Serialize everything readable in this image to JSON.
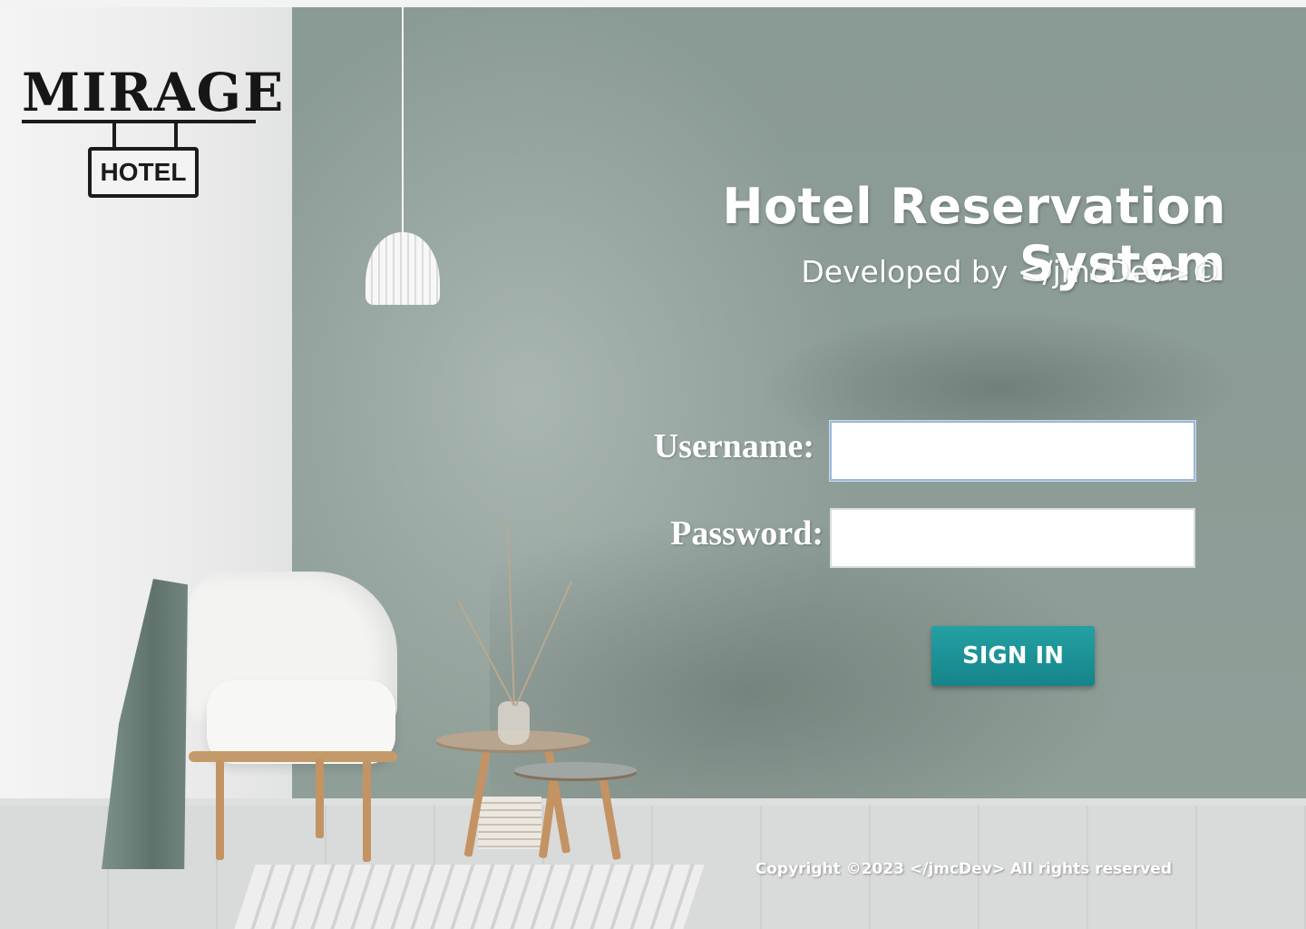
{
  "logo": {
    "name": "MIRAGE",
    "sign": "HOTEL"
  },
  "header": {
    "title": "Hotel Reservation System",
    "subtitle": "Developed by </jmcDev>©"
  },
  "login": {
    "username_label": "Username:",
    "username_value": "",
    "password_label": "Password:",
    "password_value": "",
    "submit_label": "SIGN IN"
  },
  "footer": {
    "copyright": "Copyright ©2023 </jmcDev> All rights reserved"
  },
  "colors": {
    "accent": "#1a9599",
    "wall": "#8d9c96"
  },
  "icons": []
}
